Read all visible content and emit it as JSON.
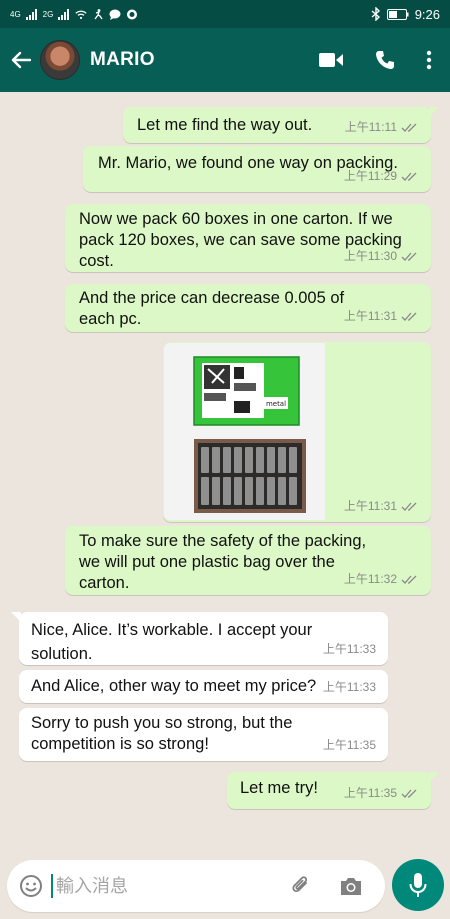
{
  "status_bar": {
    "left_signal_1": "4G",
    "left_signal_2": "2G",
    "time": "9:26"
  },
  "header": {
    "contact_name": "MARIO"
  },
  "messages": [
    {
      "dir": "out",
      "text": "Let me find the way out.",
      "time": "上午11:11"
    },
    {
      "dir": "out",
      "text": "Mr. Mario, we found one way on packing.",
      "time": "上午11:29"
    },
    {
      "dir": "out",
      "text": "Now we pack 60 boxes in one carton. If we pack 120 boxes, we can save some packing cost.",
      "time": "上午11:30"
    },
    {
      "dir": "out",
      "text": "And the price can decrease 0.005 of each pc.",
      "time": "上午11:31"
    },
    {
      "dir": "out",
      "type": "image",
      "image_label": "metal",
      "time": "上午11:31"
    },
    {
      "dir": "out",
      "text": "To make sure the safety of the packing, we will put one plastic bag over the carton.",
      "time": "上午11:32"
    },
    {
      "dir": "in",
      "text": "Nice, Alice. It’s workable. I accept your solution.",
      "time": "上午11:33"
    },
    {
      "dir": "in",
      "text": "And Alice, other way to meet my price?",
      "time": "上午11:33"
    },
    {
      "dir": "in",
      "text": "Sorry to push you so strong, but the competition is so strong!",
      "time": "上午11:35"
    },
    {
      "dir": "out",
      "text": "Let me try!",
      "time": "上午11:35"
    }
  ],
  "composer": {
    "placeholder": "輸入消息"
  },
  "colors": {
    "header": "#075e54",
    "status": "#054d44",
    "outgoing": "#dcf8c6",
    "incoming": "#ffffff",
    "accent": "#00897b",
    "wallpaper": "#ece5dd"
  }
}
